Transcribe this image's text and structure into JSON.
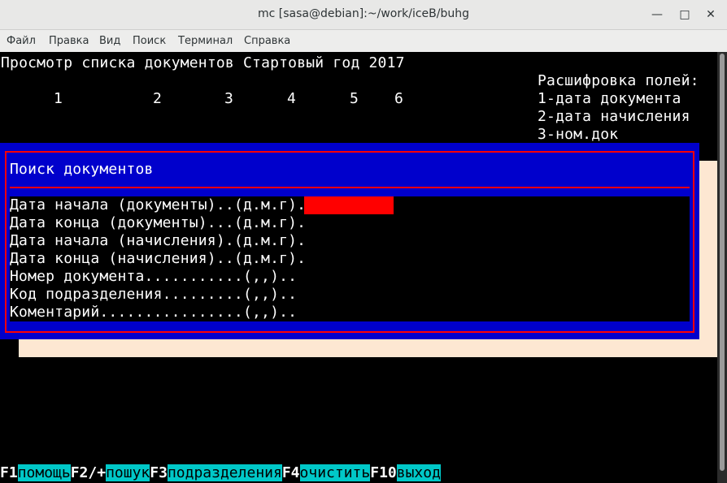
{
  "window": {
    "title": "mc [sasa@debian]:~/work/iceB/buhg"
  },
  "menu": [
    "Файл",
    "Правка",
    "Вид",
    "Поиск",
    "Терминал",
    "Справка"
  ],
  "header": {
    "title": "Просмотр списка документов Стартовый год 2017",
    "columns": [
      "1",
      "2",
      "3",
      "4",
      "5",
      "6"
    ],
    "legend": [
      "Расшифровка полей:",
      "1-дата документа",
      "2-дата начисления",
      "3-ном.док"
    ]
  },
  "dialog": {
    "title": "Поиск документов",
    "fields": [
      "Дата начала (документы)..(д.м.г).",
      "Дата конца (документы)...(д.м.г).",
      "Дата начала (начисления).(д.м.г).",
      "Дата конца (начисления)..(д.м.г).",
      "Номер документа...........(,,)..",
      "Код подразделения.........(,,)..",
      "Коментарий................(,,).."
    ]
  },
  "fkeys": [
    {
      "key": "F1",
      "label": "помощь"
    },
    {
      "key": "F2/+",
      "label": "пошук"
    },
    {
      "key": "F3",
      "label": "подразделения"
    },
    {
      "key": "F4",
      "label": "очистить"
    },
    {
      "key": "F10",
      "label": "выход"
    }
  ],
  "colors": {
    "dialog_bg": "#0000cc",
    "frame": "#ff0000",
    "fkey_label_bg": "#00c8c8",
    "shadow": "#fde7d2"
  }
}
